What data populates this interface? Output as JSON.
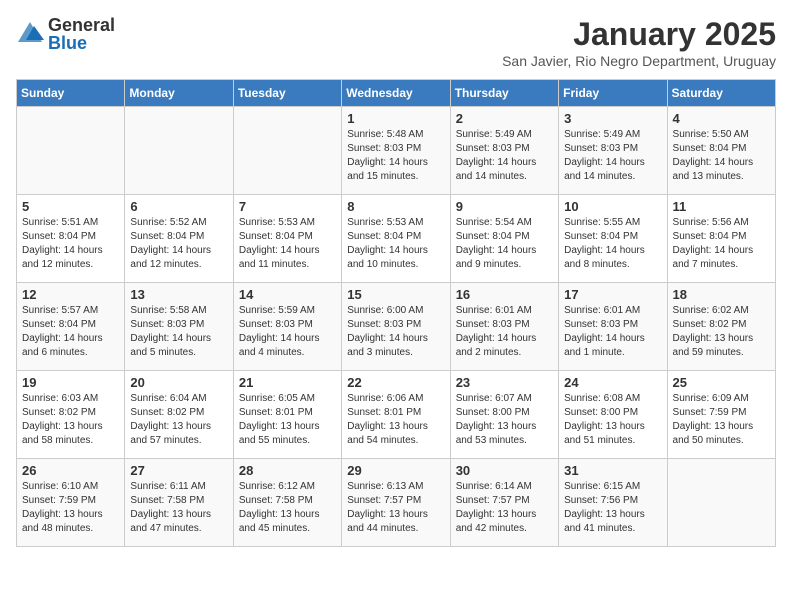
{
  "header": {
    "logo_general": "General",
    "logo_blue": "Blue",
    "month_title": "January 2025",
    "subtitle": "San Javier, Rio Negro Department, Uruguay"
  },
  "days_of_week": [
    "Sunday",
    "Monday",
    "Tuesday",
    "Wednesday",
    "Thursday",
    "Friday",
    "Saturday"
  ],
  "weeks": [
    [
      {
        "day": "",
        "info": ""
      },
      {
        "day": "",
        "info": ""
      },
      {
        "day": "",
        "info": ""
      },
      {
        "day": "1",
        "info": "Sunrise: 5:48 AM\nSunset: 8:03 PM\nDaylight: 14 hours\nand 15 minutes."
      },
      {
        "day": "2",
        "info": "Sunrise: 5:49 AM\nSunset: 8:03 PM\nDaylight: 14 hours\nand 14 minutes."
      },
      {
        "day": "3",
        "info": "Sunrise: 5:49 AM\nSunset: 8:03 PM\nDaylight: 14 hours\nand 14 minutes."
      },
      {
        "day": "4",
        "info": "Sunrise: 5:50 AM\nSunset: 8:04 PM\nDaylight: 14 hours\nand 13 minutes."
      }
    ],
    [
      {
        "day": "5",
        "info": "Sunrise: 5:51 AM\nSunset: 8:04 PM\nDaylight: 14 hours\nand 12 minutes."
      },
      {
        "day": "6",
        "info": "Sunrise: 5:52 AM\nSunset: 8:04 PM\nDaylight: 14 hours\nand 12 minutes."
      },
      {
        "day": "7",
        "info": "Sunrise: 5:53 AM\nSunset: 8:04 PM\nDaylight: 14 hours\nand 11 minutes."
      },
      {
        "day": "8",
        "info": "Sunrise: 5:53 AM\nSunset: 8:04 PM\nDaylight: 14 hours\nand 10 minutes."
      },
      {
        "day": "9",
        "info": "Sunrise: 5:54 AM\nSunset: 8:04 PM\nDaylight: 14 hours\nand 9 minutes."
      },
      {
        "day": "10",
        "info": "Sunrise: 5:55 AM\nSunset: 8:04 PM\nDaylight: 14 hours\nand 8 minutes."
      },
      {
        "day": "11",
        "info": "Sunrise: 5:56 AM\nSunset: 8:04 PM\nDaylight: 14 hours\nand 7 minutes."
      }
    ],
    [
      {
        "day": "12",
        "info": "Sunrise: 5:57 AM\nSunset: 8:04 PM\nDaylight: 14 hours\nand 6 minutes."
      },
      {
        "day": "13",
        "info": "Sunrise: 5:58 AM\nSunset: 8:03 PM\nDaylight: 14 hours\nand 5 minutes."
      },
      {
        "day": "14",
        "info": "Sunrise: 5:59 AM\nSunset: 8:03 PM\nDaylight: 14 hours\nand 4 minutes."
      },
      {
        "day": "15",
        "info": "Sunrise: 6:00 AM\nSunset: 8:03 PM\nDaylight: 14 hours\nand 3 minutes."
      },
      {
        "day": "16",
        "info": "Sunrise: 6:01 AM\nSunset: 8:03 PM\nDaylight: 14 hours\nand 2 minutes."
      },
      {
        "day": "17",
        "info": "Sunrise: 6:01 AM\nSunset: 8:03 PM\nDaylight: 14 hours\nand 1 minute."
      },
      {
        "day": "18",
        "info": "Sunrise: 6:02 AM\nSunset: 8:02 PM\nDaylight: 13 hours\nand 59 minutes."
      }
    ],
    [
      {
        "day": "19",
        "info": "Sunrise: 6:03 AM\nSunset: 8:02 PM\nDaylight: 13 hours\nand 58 minutes."
      },
      {
        "day": "20",
        "info": "Sunrise: 6:04 AM\nSunset: 8:02 PM\nDaylight: 13 hours\nand 57 minutes."
      },
      {
        "day": "21",
        "info": "Sunrise: 6:05 AM\nSunset: 8:01 PM\nDaylight: 13 hours\nand 55 minutes."
      },
      {
        "day": "22",
        "info": "Sunrise: 6:06 AM\nSunset: 8:01 PM\nDaylight: 13 hours\nand 54 minutes."
      },
      {
        "day": "23",
        "info": "Sunrise: 6:07 AM\nSunset: 8:00 PM\nDaylight: 13 hours\nand 53 minutes."
      },
      {
        "day": "24",
        "info": "Sunrise: 6:08 AM\nSunset: 8:00 PM\nDaylight: 13 hours\nand 51 minutes."
      },
      {
        "day": "25",
        "info": "Sunrise: 6:09 AM\nSunset: 7:59 PM\nDaylight: 13 hours\nand 50 minutes."
      }
    ],
    [
      {
        "day": "26",
        "info": "Sunrise: 6:10 AM\nSunset: 7:59 PM\nDaylight: 13 hours\nand 48 minutes."
      },
      {
        "day": "27",
        "info": "Sunrise: 6:11 AM\nSunset: 7:58 PM\nDaylight: 13 hours\nand 47 minutes."
      },
      {
        "day": "28",
        "info": "Sunrise: 6:12 AM\nSunset: 7:58 PM\nDaylight: 13 hours\nand 45 minutes."
      },
      {
        "day": "29",
        "info": "Sunrise: 6:13 AM\nSunset: 7:57 PM\nDaylight: 13 hours\nand 44 minutes."
      },
      {
        "day": "30",
        "info": "Sunrise: 6:14 AM\nSunset: 7:57 PM\nDaylight: 13 hours\nand 42 minutes."
      },
      {
        "day": "31",
        "info": "Sunrise: 6:15 AM\nSunset: 7:56 PM\nDaylight: 13 hours\nand 41 minutes."
      },
      {
        "day": "",
        "info": ""
      }
    ]
  ]
}
